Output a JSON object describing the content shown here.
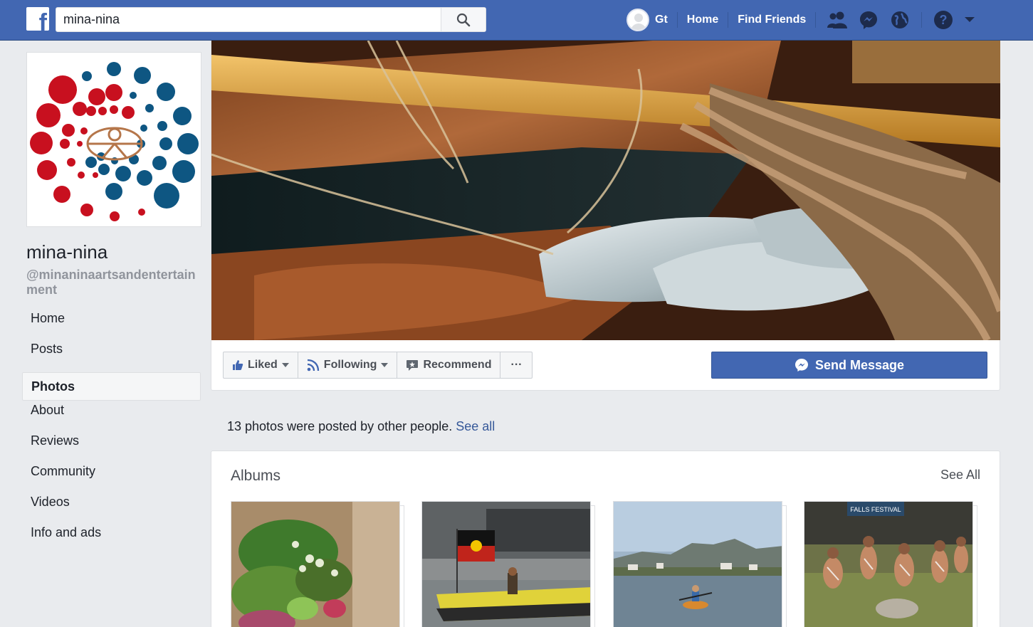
{
  "topbar": {
    "search_value": "mina-nina",
    "user_name": "Gt",
    "home_label": "Home",
    "find_friends_label": "Find Friends",
    "brand_color": "#4267b2"
  },
  "page": {
    "name": "mina-nina",
    "handle": "@minaninaartsandentertainment"
  },
  "sidebar": {
    "items": [
      {
        "label": "Home"
      },
      {
        "label": "Posts"
      },
      {
        "label": "Photos",
        "active": true
      },
      {
        "label": "About"
      },
      {
        "label": "Reviews"
      },
      {
        "label": "Community"
      },
      {
        "label": "Videos"
      },
      {
        "label": "Info and ads"
      }
    ]
  },
  "actions": {
    "liked_label": "Liked",
    "following_label": "Following",
    "recommend_label": "Recommend",
    "more_label": "···",
    "send_message_label": "Send Message"
  },
  "photos": {
    "posted_by_text": "13 photos were posted by other people.",
    "see_all_link": "See all"
  },
  "albums": {
    "title": "Albums",
    "see_all": "See All",
    "thumbs": [
      "album-thumb-food",
      "album-thumb-flag-boat",
      "album-thumb-kayak",
      "album-thumb-festival"
    ],
    "festival_banner": "FALLS FESTIVAL"
  }
}
